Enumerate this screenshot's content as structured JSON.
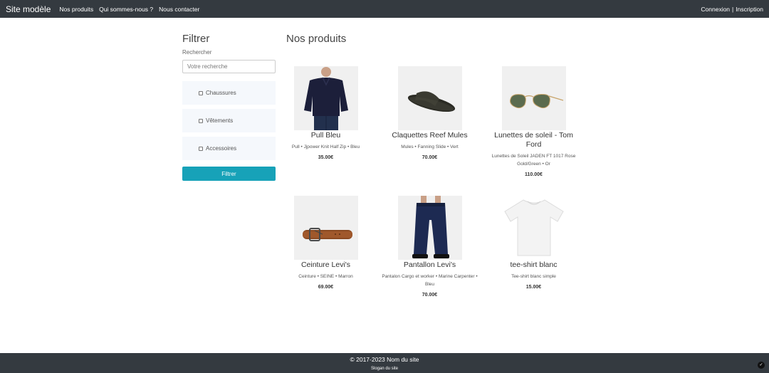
{
  "navbar": {
    "brand": "Site modèle",
    "links": [
      "Nos produits",
      "Qui sommes-nous ?",
      "Nous contacter"
    ],
    "login": "Connexion",
    "separator": "|",
    "register": "Inscription"
  },
  "sidebar": {
    "title": "Filtrer",
    "search_label": "Rechercher",
    "search_placeholder": "Votre recherche",
    "categories": [
      "Chaussures",
      "Vêtements",
      "Accessoires"
    ],
    "filter_button": "Filtrer"
  },
  "main": {
    "title": "Nos produits",
    "products": [
      {
        "name": "Pull Bleu",
        "desc": "Pull • Jjpower Knit Half Zip • Bleu",
        "price": "35.00€",
        "image": "sweater"
      },
      {
        "name": "Claquettes Reef Mules",
        "desc": "Mules • Fanning Slide • Vert",
        "price": "70.00€",
        "image": "slide-sandal"
      },
      {
        "name": "Lunettes de soleil - Tom Ford",
        "desc": "Lunettes de Soleil JADEN FT 1017 Rose Gold/Green • Or",
        "price": "110.00€",
        "image": "sunglasses"
      },
      {
        "name": "Ceinture Levi's",
        "desc": "Ceinture • SEINE • Marron",
        "price": "69.00€",
        "image": "belt"
      },
      {
        "name": "Pantallon Levi's",
        "desc": "Pantalon Cargo et worker • Marine Carpenter • Bleu",
        "price": "70.00€",
        "image": "jeans"
      },
      {
        "name": "tee-shirt blanc",
        "desc": "Tee-shirt blanc simple",
        "price": "15.00€",
        "image": "white-tshirt"
      }
    ]
  },
  "footer": {
    "copyright": "© 2017-2023 Nom du site",
    "slogan": "Slogan du site"
  }
}
